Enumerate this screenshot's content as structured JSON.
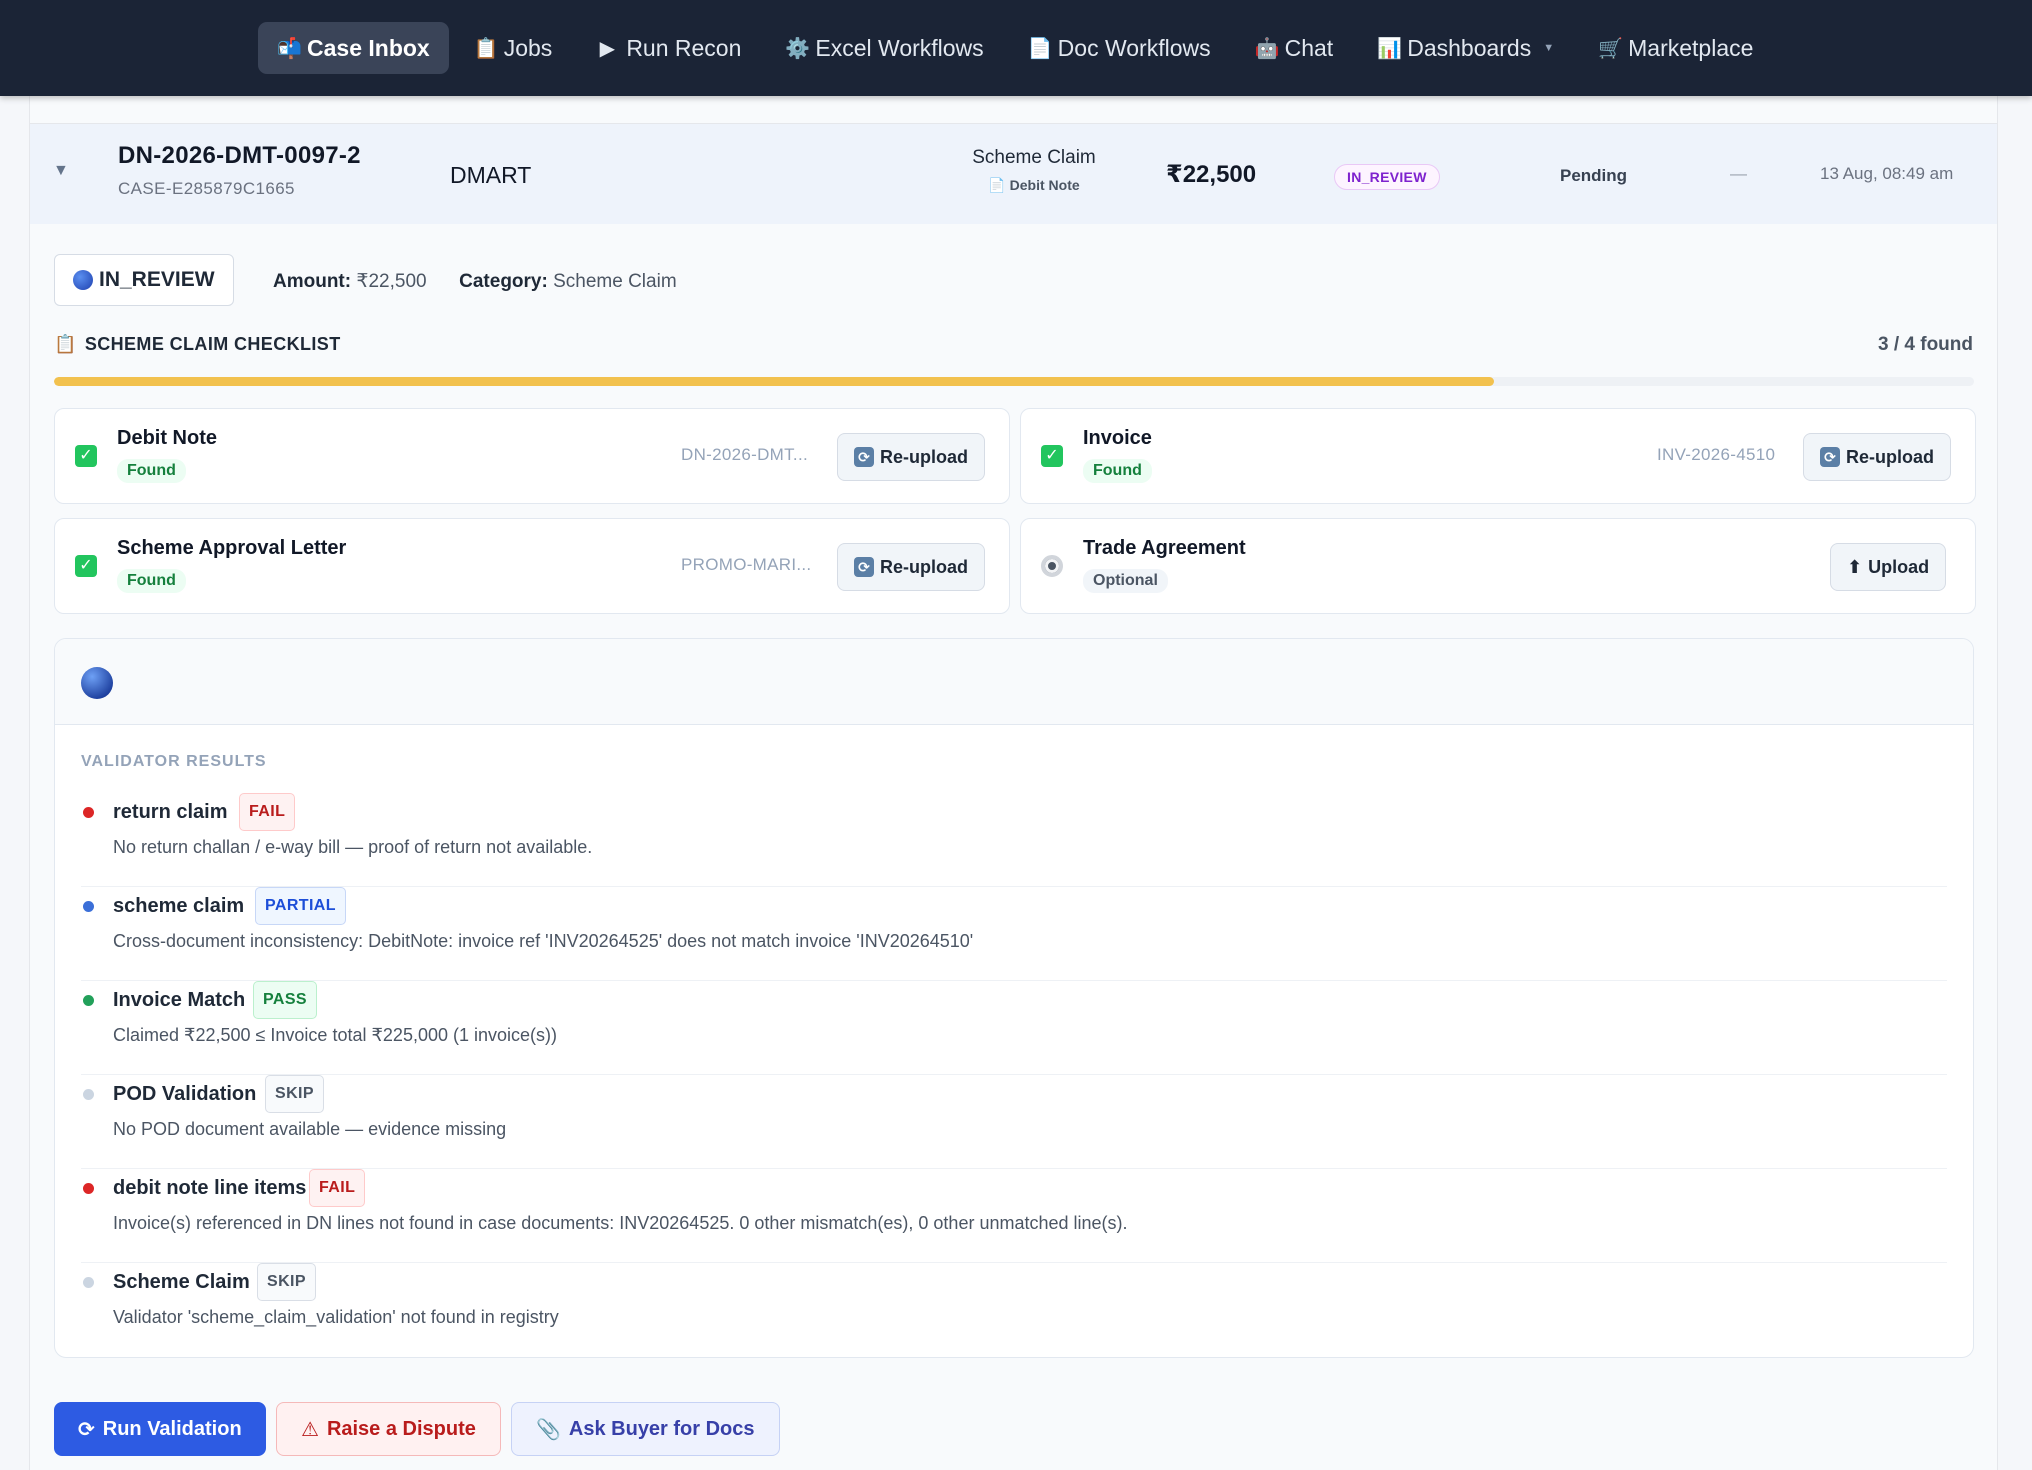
{
  "nav": {
    "items": [
      {
        "icon": "📬",
        "label": "Case Inbox",
        "active": true
      },
      {
        "icon": "📋",
        "label": "Jobs"
      },
      {
        "icon": "▶",
        "label": "Run Recon"
      },
      {
        "icon": "⚙️",
        "label": "Excel Workflows"
      },
      {
        "icon": "📄",
        "label": "Doc Workflows"
      },
      {
        "icon": "🤖",
        "label": "Chat"
      },
      {
        "icon": "📊",
        "label": "Dashboards",
        "dropdown": true
      },
      {
        "icon": "🛒",
        "label": "Marketplace"
      }
    ],
    "dropdown_caret": "▼"
  },
  "case": {
    "expand_icon": "▼",
    "id": "DN-2026-DMT-0097-2",
    "case_ref": "CASE-E285879C1665",
    "buyer": "DMART",
    "claim_type": "Scheme Claim",
    "doc_type_icon": "📄",
    "doc_type": "Debit Note",
    "amount": "₹22,500",
    "status": "IN_REVIEW",
    "approval": "Pending",
    "assignee": "—",
    "date": "13 Aug, 08:49 am"
  },
  "detail": {
    "status_chip": "IN_REVIEW",
    "amount_label": "Amount:",
    "amount_value": "₹22,500",
    "category_label": "Category:",
    "category_value": "Scheme Claim"
  },
  "checklist": {
    "icon": "📋",
    "title": "SCHEME CLAIM CHECKLIST",
    "found_label": "3 / 4 found",
    "progress_fraction": 0.75,
    "progress_color": "#f2c14e",
    "documents": [
      {
        "name": "Debit Note",
        "status": "Found",
        "ref": "DN-2026-DMT...",
        "button": "Re-upload",
        "button_icon": "🔄",
        "checked": true
      },
      {
        "name": "Invoice",
        "status": "Found",
        "ref": "INV-2026-4510",
        "button": "Re-upload",
        "button_icon": "🔄",
        "checked": true
      },
      {
        "name": "Scheme Approval Letter",
        "status": "Found",
        "ref": "PROMO-MARI...",
        "button": "Re-upload",
        "button_icon": "🔄",
        "checked": true
      },
      {
        "name": "Trade Agreement",
        "status": "Optional",
        "ref": "",
        "button": "Upload",
        "button_icon": "⬆",
        "checked": false
      }
    ]
  },
  "validator": {
    "title": "VALIDATOR RESULTS",
    "results": [
      {
        "name": "return claim",
        "badge": "FAIL",
        "dot_color": "#dc2626",
        "description": "No return challan / e-way bill — proof of return not available."
      },
      {
        "name": "scheme claim",
        "badge": "PARTIAL",
        "dot_color": "#3b6fd8",
        "description": "Cross-document inconsistency: DebitNote: invoice ref 'INV20264525' does not match invoice 'INV20264510'"
      },
      {
        "name": "Invoice Match",
        "badge": "PASS",
        "dot_color": "#22a05a",
        "description": "Claimed ₹22,500 ≤ Invoice total ₹225,000 (1 invoice(s))"
      },
      {
        "name": "POD Validation",
        "badge": "SKIP",
        "dot_color": "#cbd5e1",
        "description": "No POD document available — evidence missing"
      },
      {
        "name": "debit note line items",
        "badge": "FAIL",
        "dot_color": "#dc2626",
        "description": "Invoice(s) referenced in DN lines not found in case documents: INV20264525. 0 other mismatch(es), 0 other unmatched line(s)."
      },
      {
        "name": "Scheme Claim",
        "badge": "SKIP",
        "dot_color": "#cbd5e1",
        "description": "Validator 'scheme_claim_validation' not found in registry"
      }
    ]
  },
  "actions": {
    "run_validation_icon": "⟳",
    "run_validation": "Run Validation",
    "raise_dispute_icon": "⚠",
    "raise_dispute": "Raise a Dispute",
    "ask_buyer_icon": "📎",
    "ask_buyer": "Ask Buyer for Docs"
  }
}
